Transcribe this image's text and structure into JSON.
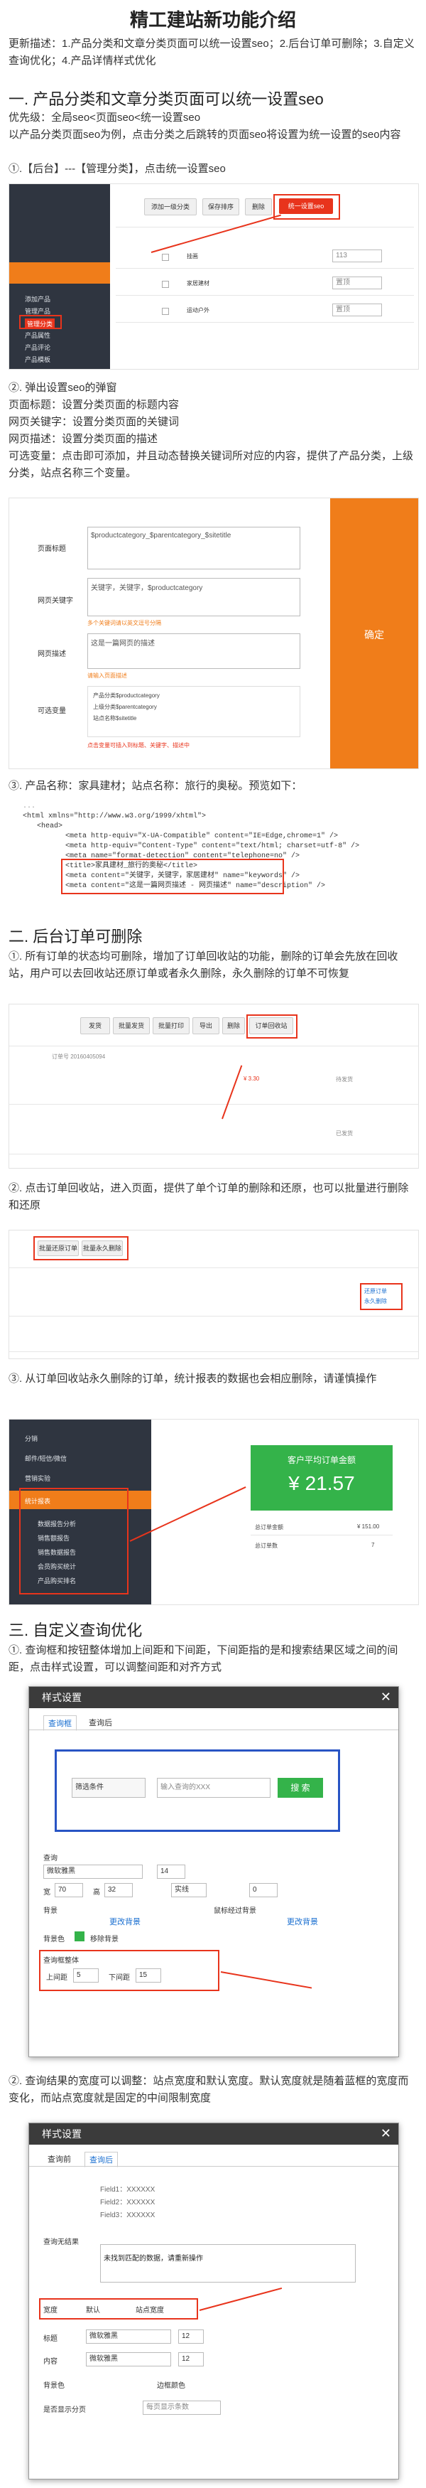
{
  "page": {
    "title": "精工建站新功能介绍",
    "intro": "更新描述：1.产品分类和文章分类页面可以统一设置seo；2.后台订单可删除；3.自定义查询优化；4.产品详情样式优化"
  },
  "section1": {
    "heading": "一. 产品分类和文章分类页面可以统一设置seo",
    "text1": "优先级：全局seo<页面seo<统一设置seo",
    "text2": "以产品分类页面seo为例，点击分类之后跳转的页面seo将设置为统一设置的seo内容",
    "step1": "①.【后台】---【管理分类】，点击统一设置seo",
    "shot1": {
      "sidebar_items": [
        "添加产品",
        "管理产品",
        "管理分类",
        "产品属性",
        "产品评论",
        "产品模板"
      ],
      "buttons": [
        "添加一级分类",
        "保存排序",
        "删除",
        "统一设置seo"
      ],
      "rows": [
        {
          "name": "挂画",
          "order": "113"
        },
        {
          "name": "家居建材",
          "order": "置顶"
        },
        {
          "name": "运动户外",
          "order": "置顶"
        }
      ]
    },
    "step2": "②. 弹出设置seo的弹窗",
    "step2_lines": [
      "页面标题：设置分类页面的标题内容",
      "网页关键字：设置分类页面的关键词",
      "网页描述：设置分类页面的描述",
      "可选变量：点击即可添加，并且动态替换关键词所对应的内容，提供了产品分类，上级分类，站点名称三个变量。"
    ],
    "shot2": {
      "labels": [
        "页面标题",
        "网页关键字",
        "网页描述",
        "可选变量"
      ],
      "title_value": "$productcategory_$parentcategory_$sitetitle",
      "keyword_value": "关键字，关键字，$productcategory",
      "keyword_hint": "多个关键词请以英文逗号分隔",
      "desc_value": "这是一篇网页的描述",
      "desc_hint": "请输入页面描述",
      "variables": [
        "产品分类$productcategory",
        "上级分类$parentcategory",
        "站点名称$sitetitle"
      ],
      "variables_hint": "点击变量可插入到标题、关键字、描述中",
      "confirm": "确定"
    },
    "step3": "③. 产品名称：家具建材；站点名称：旅行的奥秘。预览如下：",
    "code_lines": [
      "<html xmlns=\"http://www.w3.org/1999/xhtml\">",
      "<head>",
      "<meta http-equiv=\"X-UA-Compatible\" content=\"IE=Edge,chrome=1\" />",
      "<meta http-equiv=\"Content-Type\" content=\"text/html; charset=utf-8\" />",
      "<meta name=\"format-detection\" content=\"telephone=no\" />",
      "<title>家具建材_旅行的奥秘</title>",
      "<meta content=\"关键字，关键字，家居建材\" name=\"keywords\" />",
      "<meta content=\"这是一篇网页描述 - 网页描述\" name=\"description\" />"
    ]
  },
  "section2": {
    "heading": "二. 后台订单可删除",
    "step1": "①. 所有订单的状态均可删除，增加了订单回收站的功能，删除的订单会先放在回收站，用户可以去回收站还原订单或者永久删除，永久删除的订单不可恢复",
    "shot1": {
      "buttons": [
        "发货",
        "批量发货",
        "批量打印",
        "导出",
        "删除",
        "订单回收站"
      ],
      "order_no": "订单号 20160405094",
      "amount": "¥ 3.30",
      "status": [
        "待发货",
        "已发货"
      ]
    },
    "step2": "②. 点击订单回收站，进入页面，提供了单个订单的删除和还原，也可以批量进行删除和还原",
    "shot2": {
      "buttons": [
        "批量还原订单",
        "批量永久删除"
      ],
      "actions": [
        "还原订单",
        "永久删除"
      ]
    },
    "step3": "③. 从订单回收站永久删除的订单，统计报表的数据也会相应删除，请谨慎操作",
    "shot3": {
      "menu_top": [
        "分销",
        "邮件/短信/微信",
        "营销实验"
      ],
      "menu_active": "统计报表",
      "menu_sub": [
        "数据报告分析",
        "销售额报告",
        "销售数据报告",
        "会员购买统计",
        "产品购买排名"
      ],
      "stat_title": "客户平均订单金额",
      "stat_value": "¥ 21.57",
      "rows": [
        {
          "label": "总订单金额",
          "value": "¥ 151.00"
        },
        {
          "label": "总订单数",
          "value": "7"
        }
      ]
    }
  },
  "section3": {
    "heading": "三. 自定义查询优化",
    "step1": "①. 查询框和按钮整体增加上间距和下间距，下间距指的是和搜索结果区域之间的间距，点击样式设置，可以调整间距和对齐方式",
    "dialog1": {
      "title": "样式设置",
      "tabs": [
        "查询框",
        "查询后"
      ],
      "filter_label": "筛选条件",
      "search_placeholder": "输入查询的XXX",
      "search_btn": "搜 索",
      "query_label": "查询",
      "font": "微软雅黑",
      "font_size": "14",
      "width_label": "宽",
      "width_value": "70",
      "height_label": "高",
      "height_value": "32",
      "border_style": "实线",
      "border_width": "0",
      "bg_label": "背景",
      "change_bg": "更改背景",
      "hover_bg_label": "鼠标经过背景",
      "bg_color": "背景色",
      "remove_bg": "移除背景",
      "spacing_section": "查询框整体",
      "top_label": "上间距",
      "top_value": "5",
      "bottom_label": "下间距",
      "bottom_value": "15"
    },
    "step2": "②. 查询结果的宽度可以调整：站点宽度和默认宽度。默认宽度就是随着蓝框的宽度而变化，而站点宽度就是固定的中间限制宽度",
    "dialog2": {
      "title": "样式设置",
      "tabs": [
        "查询前",
        "查询后"
      ],
      "fields": [
        "Field1：XXXXXX",
        "Field2：XXXXXX",
        "Field3：XXXXXX"
      ],
      "prompt_label": "查询无结果",
      "prompt_text": "未找到匹配的数据，请重新操作",
      "width_label": "宽度",
      "width_options": [
        "默认",
        "站点宽度"
      ],
      "title_label": "标题",
      "content_label": "内容",
      "bg_label": "背景色",
      "border_label": "边框颜色",
      "paging_label": "是否显示分页",
      "paging_value": "每页显示条数",
      "font": "微软雅黑",
      "size": "12"
    }
  },
  "colors": {
    "accent": "#e8341c",
    "orange": "#f07d1a",
    "green": "#34b34a",
    "blue": "#1a6fd0",
    "dark": "#2f3540"
  }
}
